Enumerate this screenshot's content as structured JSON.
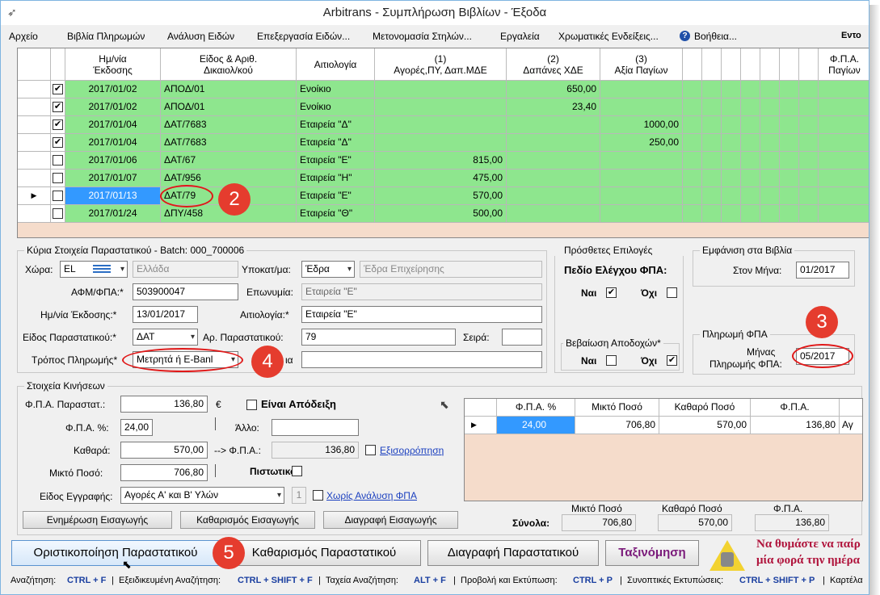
{
  "window": {
    "title": "Arbitrans - Συμπλήρωση Βιβλίων - Έξοδα"
  },
  "menu": {
    "items": [
      "Αρχείο",
      "Βιβλία Πληρωμών",
      "Ανάλυση Ειδών",
      "Επεξεργασία Ειδών...",
      "Μετονομασία Στηλών...",
      "Εργαλεία",
      "Χρωματικές Ενδείξεις...",
      "Βοήθεια...",
      "Εντο"
    ]
  },
  "grid": {
    "headers": [
      "Ημ/νία\nΈκδοσης",
      "Είδος & Αριθ.\nΔικαιολ/κού",
      "Αιτιολογία",
      "(1)\nΑγορές,ΠΥ, Δαπ.ΜΔΕ",
      "(2)\nΔαπάνες ΧΔΕ",
      "(3)\nΑξία Παγίων",
      "Φ.Π.Α.\nΠαγίων"
    ],
    "rows": [
      {
        "checked": true,
        "date": "2017/01/02",
        "doc": "ΑΠΟΔ/01",
        "reason": "Ενοίκιο",
        "c1": "",
        "c2": "650,00",
        "c3": ""
      },
      {
        "checked": true,
        "date": "2017/01/02",
        "doc": "ΑΠΟΔ/01",
        "reason": "Ενοίκιο",
        "c1": "",
        "c2": "23,40",
        "c3": ""
      },
      {
        "checked": true,
        "date": "2017/01/04",
        "doc": "ΔΑΤ/7683",
        "reason": "Εταιρεία \"Δ\"",
        "c1": "",
        "c2": "",
        "c3": "1000,00"
      },
      {
        "checked": true,
        "date": "2017/01/04",
        "doc": "ΔΑΤ/7683",
        "reason": "Εταιρεία \"Δ\"",
        "c1": "",
        "c2": "",
        "c3": "250,00"
      },
      {
        "checked": false,
        "date": "2017/01/06",
        "doc": "ΔΑΤ/67",
        "reason": "Εταιρεία \"Ε\"",
        "c1": "815,00",
        "c2": "",
        "c3": ""
      },
      {
        "checked": false,
        "date": "2017/01/07",
        "doc": "ΔΑΤ/956",
        "reason": "Εταιρεία \"Η\"",
        "c1": "475,00",
        "c2": "",
        "c3": ""
      },
      {
        "checked": false,
        "date": "2017/01/13",
        "doc": "ΔΑΤ/79",
        "reason": "Εταιρεία \"Ε\"",
        "c1": "570,00",
        "c2": "",
        "c3": ""
      },
      {
        "checked": false,
        "date": "2017/01/24",
        "doc": "ΔΠΥ/458",
        "reason": "Εταιρεία \"Θ\"",
        "c1": "500,00",
        "c2": "",
        "c3": ""
      }
    ]
  },
  "main": {
    "title": "Κύρια Στοιχεία Παραστατικού - Batch: 000_700006",
    "country_label": "Χώρα:",
    "country_code": "EL",
    "country_name": "Ελλάδα",
    "branch_label": "Υποκατ/μα:",
    "branch_value": "Έδρα",
    "branch_desc": "Έδρα Επιχείρησης",
    "afm_label": "ΑΦΜ/ΦΠΑ:*",
    "afm_value": "503900047",
    "name_label": "Επωνυμία:",
    "name_value": "Εταιρεία \"Ε\"",
    "issue_date_label": "Ημ/νία Έκδοσης:*",
    "issue_date_value": "13/01/2017",
    "reason_label": "Αιτιολογία:*",
    "reason_value": "Εταιρεία \"Ε\"",
    "doc_type_label": "Είδος Παραστατικού:*",
    "doc_type_value": "ΔΑΤ",
    "doc_no_label": "Αρ. Παραστατικού:",
    "doc_no_value": "79",
    "series_label": "Σειρά:",
    "series_value": "",
    "payment_label": "Τρόπος Πληρωμής*",
    "payment_value": "Μετρητά ή E-Banl",
    "extra_label": "ια"
  },
  "extra": {
    "title": "Πρόσθετες Επιλογές",
    "vat_check_label": "Πεδίο Ελέγχου ΦΠΑ:",
    "yes": "Ναι",
    "no": "Όχι",
    "cert_title": "Βεβαίωση Αποδοχών*"
  },
  "books": {
    "title": "Εμφάνιση στα Βιβλία",
    "month_label": "Στον Μήνα:",
    "month_value": "01/2017"
  },
  "vat_payment": {
    "title": "Πληρωμή ΦΠΑ",
    "month_label_1": "Μήνας",
    "month_label_2": "Πληρωμής ΦΠΑ:",
    "month_value": "05/2017"
  },
  "moves": {
    "title": "Στοιχεία Κινήσεων",
    "vat_doc_label": "Φ.Π.Α. Παραστατ.:",
    "vat_doc_value": "136,80",
    "euro": "€",
    "receipt_label": "Είναι Απόδειξη",
    "vat_pct_label": "Φ.Π.Α. %:",
    "vat_pct_value": "24,00",
    "other_label": "Άλλο:",
    "other_value": "",
    "net_label": "Καθαρά:",
    "net_value": "570,00",
    "arrow_vat_label": "--> Φ.Π.Α.:",
    "arrow_vat_value": "136,80",
    "balance_label": "Εξισορρόπηση",
    "gross_label": "Μικτό Ποσό:",
    "gross_value": "706,80",
    "credit_label": "Πιστωτικό",
    "entry_type_label": "Είδος Εγγραφής:",
    "entry_type_value": "Αγορές Α' και Β' Υλών",
    "entry_count": "1",
    "no_vat_label": "Χωρίς Ανάλυση ΦΠΑ",
    "btn_update": "Ενημέρωση Εισαγωγής",
    "btn_clear": "Καθαρισμός Εισαγωγής",
    "btn_delete": "Διαγραφή Εισαγωγής"
  },
  "summary_grid": {
    "headers": [
      "Φ.Π.Α. %",
      "Μικτό Ποσό",
      "Καθαρό Ποσό",
      "Φ.Π.Α.",
      ""
    ],
    "row": [
      "24,00",
      "706,80",
      "570,00",
      "136,80",
      "Αγ"
    ]
  },
  "totals": {
    "label": "Σύνολα:",
    "gross_label": "Μικτό Ποσό",
    "gross_value": "706,80",
    "net_label": "Καθαρό Ποσό",
    "net_value": "570,00",
    "vat_label": "Φ.Π.Α.",
    "vat_value": "136,80"
  },
  "bottom_buttons": {
    "finalize": "Οριστικοποίηση Παραστατικού",
    "clear": "Καθαρισμός Παραστατικού",
    "delete": "Διαγραφή Παραστατικού",
    "sort": "Ταξινόμηση"
  },
  "reminder": {
    "line1": "Να θυμάστε να παίρ",
    "line2": "μία φορά την ημέρα"
  },
  "annotations": {
    "b1": "2",
    "b2": "3",
    "b3": "4",
    "b4": "5"
  },
  "statusbar": {
    "search_label": "Αναζήτηση:",
    "search_key": "CTRL + F",
    "adv_label": "Εξειδικευμένη Αναζήτηση:",
    "adv_key": "CTRL + SHIFT + F",
    "quick_label": "Ταχεία Αναζήτηση:",
    "quick_key": "ALT + F",
    "print_label": "Προβολή και Εκτύπωση:",
    "print_key": "CTRL + P",
    "reports_label": "Συνοπτικές Εκτυπώσεις:",
    "reports_key": "CTRL + SHIFT + P",
    "cards_label": "Καρτέλα"
  },
  "colors": {
    "row_green": "#8ee68e",
    "selected_blue": "#3399ff",
    "annotation_red": "#e53c2e"
  }
}
